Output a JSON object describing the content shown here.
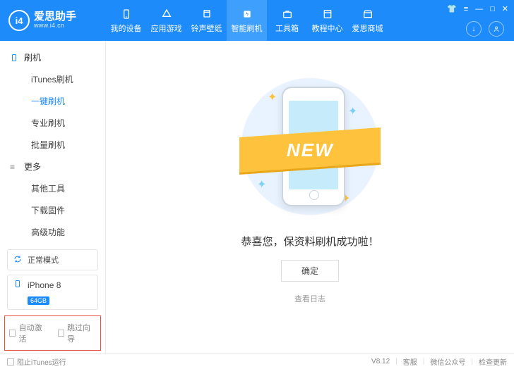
{
  "app": {
    "name": "爱思助手",
    "url": "www.i4.cn",
    "logo_letters": "i4"
  },
  "nav": [
    {
      "label": "我的设备",
      "icon": "phone"
    },
    {
      "label": "应用游戏",
      "icon": "app"
    },
    {
      "label": "铃声壁纸",
      "icon": "music"
    },
    {
      "label": "智能刷机",
      "icon": "flash",
      "active": true
    },
    {
      "label": "工具箱",
      "icon": "toolbox"
    },
    {
      "label": "教程中心",
      "icon": "book"
    },
    {
      "label": "爱思商城",
      "icon": "store"
    }
  ],
  "sidebar": {
    "flash": {
      "title": "刷机",
      "items": [
        "iTunes刷机",
        "一键刷机",
        "专业刷机",
        "批量刷机"
      ],
      "active_index": 1
    },
    "more": {
      "title": "更多",
      "items": [
        "其他工具",
        "下载固件",
        "高级功能"
      ]
    },
    "mode_chip": "正常模式",
    "device": {
      "name": "iPhone 8",
      "storage": "64GB"
    },
    "checks": {
      "auto_activate": "自动激活",
      "skip_wizard": "跳过向导"
    }
  },
  "main": {
    "ribbon": "NEW",
    "success_text": "恭喜您，保资料刷机成功啦！",
    "ok_button": "确定",
    "log_link": "查看日志"
  },
  "footer": {
    "block_itunes": "阻止iTunes运行",
    "version": "V8.12",
    "links": [
      "客服",
      "微信公众号",
      "检查更新"
    ]
  }
}
